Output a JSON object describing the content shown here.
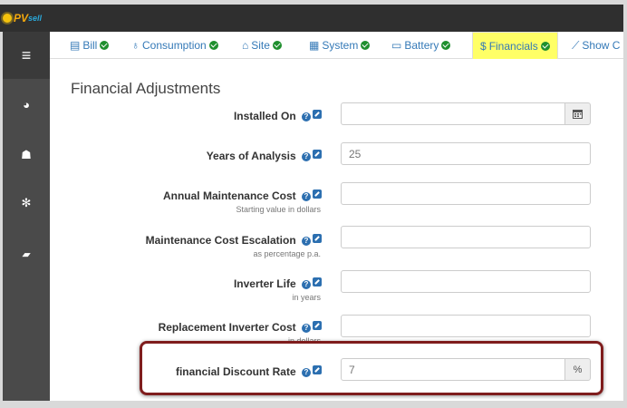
{
  "logo": {
    "pv": "PV",
    "sell": "sell"
  },
  "sidebar": {
    "items": [
      {
        "icon": "menu-icon",
        "glyph": "≡"
      },
      {
        "icon": "dashboard-icon",
        "glyph": "◕"
      },
      {
        "icon": "users-icon",
        "glyph": "☗"
      },
      {
        "icon": "settings-icon",
        "glyph": "✻"
      },
      {
        "icon": "book-icon",
        "glyph": "▰"
      }
    ]
  },
  "tabs": [
    {
      "label": "Bill",
      "icon": "file-icon",
      "glyph": "▤",
      "status": "complete"
    },
    {
      "label": "Consumption",
      "icon": "lightbulb-icon",
      "glyph": "♁",
      "status": "complete"
    },
    {
      "label": "Site",
      "icon": "home-icon",
      "glyph": "⌂",
      "status": "complete"
    },
    {
      "label": "System",
      "icon": "grid-icon",
      "glyph": "▦",
      "status": "complete"
    },
    {
      "label": "Battery",
      "icon": "battery-icon",
      "glyph": "▭",
      "status": "complete"
    },
    {
      "label": "Financials",
      "icon": "dollar-icon",
      "glyph": "$",
      "status": "complete",
      "active": true
    },
    {
      "label": "Show C",
      "icon": "chart-icon",
      "glyph": "⟋"
    }
  ],
  "panel": {
    "title": "Financial Adjustments"
  },
  "fields": [
    {
      "label": "Installed On",
      "sub": "",
      "value": "",
      "addon": "calendar-icon"
    },
    {
      "label": "Years of Analysis",
      "sub": "",
      "value": "25"
    },
    {
      "label": "Annual Maintenance Cost",
      "sub": "Starting value in dollars",
      "value": ""
    },
    {
      "label": "Maintenance Cost Escalation",
      "sub": "as percentage p.a.",
      "value": ""
    },
    {
      "label": "Inverter Life",
      "sub": "in years",
      "value": ""
    },
    {
      "label": "Replacement Inverter Cost",
      "sub": "in dollars",
      "value": ""
    },
    {
      "label": "financial Discount Rate",
      "sub": "",
      "value": "7",
      "addon_text": "%"
    }
  ],
  "colors": {
    "accent": "#3479b7",
    "active_tab": "#ffff66",
    "status_ok": "#1f8f2e",
    "highlight": "#7f1d1d"
  }
}
